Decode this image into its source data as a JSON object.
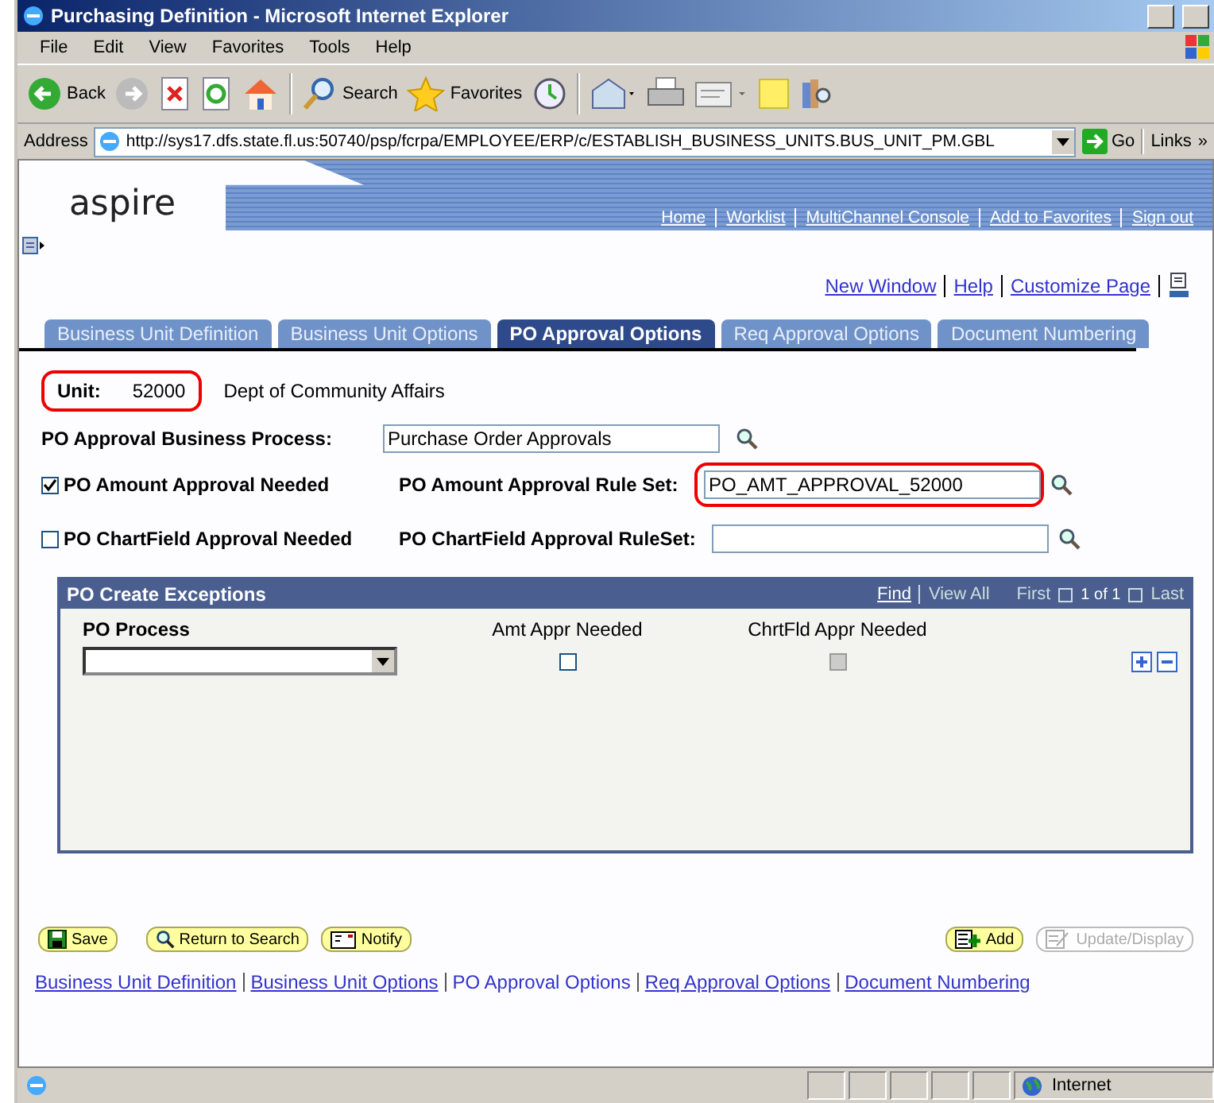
{
  "window": {
    "title": "Purchasing Definition - Microsoft Internet Explorer"
  },
  "menu": [
    "File",
    "Edit",
    "View",
    "Favorites",
    "Tools",
    "Help"
  ],
  "toolbar": {
    "back": "Back",
    "search": "Search",
    "favorites": "Favorites"
  },
  "address": {
    "label": "Address",
    "url": "http://sys17.dfs.state.fl.us:50740/psp/fcrpa/EMPLOYEE/ERP/c/ESTABLISH_BUSINESS_UNITS.BUS_UNIT_PM.GBL",
    "go": "Go",
    "links": "Links",
    "more": "»"
  },
  "header": {
    "logo": "aspire",
    "nav": [
      "Home",
      "Worklist",
      "MultiChannel Console",
      "Add to Favorites",
      "Sign out"
    ]
  },
  "page_links": [
    "New Window",
    "Help",
    "Customize Page"
  ],
  "tabs": [
    {
      "label": "Business Unit Definition",
      "selected": false
    },
    {
      "label": "Business Unit Options",
      "selected": false
    },
    {
      "label": "PO Approval Options",
      "selected": true
    },
    {
      "label": "Req Approval Options",
      "selected": false
    },
    {
      "label": "Document Numbering",
      "selected": false
    }
  ],
  "unit": {
    "label": "Unit:",
    "value": "52000",
    "description": "Dept of Community Affairs",
    "highlighted": true
  },
  "business_process": {
    "label": "PO Approval Business Process:",
    "value": "Purchase Order Approvals"
  },
  "approvals": [
    {
      "label": "PO Amount Approval Needed",
      "checked": true,
      "rule_label": "PO Amount Approval Rule Set:",
      "rule_value": "PO_AMT_APPROVAL_52000",
      "highlighted": true
    },
    {
      "label": "PO ChartField Approval Needed",
      "checked": false,
      "rule_label": "PO ChartField Approval RuleSet:",
      "highlighted": false
    }
  ],
  "grid": {
    "title": "PO Create Exceptions",
    "find": "Find",
    "view_all": "View All",
    "first": "First",
    "count": "1 of 1",
    "last": "Last",
    "columns": [
      "PO Process",
      "Amt Appr Needed",
      "ChrtFld Appr Needed"
    ],
    "rows": [
      {
        "amt_checked": false,
        "chrtfld_checked": false,
        "chrtfld_disabled": true
      }
    ]
  },
  "buttons": [
    {
      "label": "Save",
      "kind": "save",
      "disabled": false
    },
    {
      "label": "Return to Search",
      "kind": "search",
      "disabled": false
    },
    {
      "label": "Notify",
      "kind": "notify",
      "disabled": false
    }
  ],
  "right_buttons": [
    {
      "label": "Add",
      "kind": "add",
      "disabled": false
    },
    {
      "label": "Update/Display",
      "kind": "update",
      "disabled": true
    }
  ],
  "bottom_links": [
    {
      "label": "Business Unit Definition",
      "selected": false
    },
    {
      "label": "Business Unit Options",
      "selected": false
    },
    {
      "label": "PO Approval Options",
      "selected": true
    },
    {
      "label": "Req Approval Options",
      "selected": false
    },
    {
      "label": "Document Numbering",
      "selected": false
    }
  ],
  "status_bar": {
    "zone": "Internet"
  }
}
